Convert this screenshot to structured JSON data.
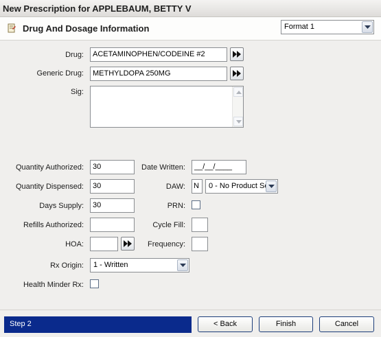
{
  "window": {
    "title": "New Prescription for APPLEBAUM, BETTY V"
  },
  "header": {
    "title": "Drug And Dosage Information",
    "format_select": "Format 1"
  },
  "form": {
    "drug_label": "Drug:",
    "drug_value": "ACETAMINOPHEN/CODEINE #2",
    "generic_label": "Generic Drug:",
    "generic_value": "METHYLDOPA 250MG",
    "sig_label": "Sig:",
    "sig_value": "",
    "qty_auth_label": "Quantity Authorized:",
    "qty_auth_value": "30",
    "qty_disp_label": "Quantity Dispensed:",
    "qty_disp_value": "30",
    "days_supply_label": "Days Supply:",
    "days_supply_value": "30",
    "refills_label": "Refills Authorized:",
    "refills_value": "",
    "hoa_label": "HOA:",
    "hoa_value": "",
    "rx_origin_label": "Rx Origin:",
    "rx_origin_value": "1 - Written",
    "health_minder_label": "Health Minder Rx:",
    "date_written_label": "Date Written:",
    "date_written_value": "__/__/____",
    "daw_label": "DAW:",
    "daw_flag": "N",
    "daw_select": "0 - No Product Se",
    "prn_label": "PRN:",
    "cycle_fill_label": "Cycle Fill:",
    "cycle_fill_value": "",
    "frequency_label": "Frequency:",
    "frequency_value": ""
  },
  "footer": {
    "step": "Step 2",
    "back": "< Back",
    "finish": "Finish",
    "cancel": "Cancel"
  },
  "colors": {
    "step_bar": "#0a2a8c",
    "background": "#f0efed"
  }
}
